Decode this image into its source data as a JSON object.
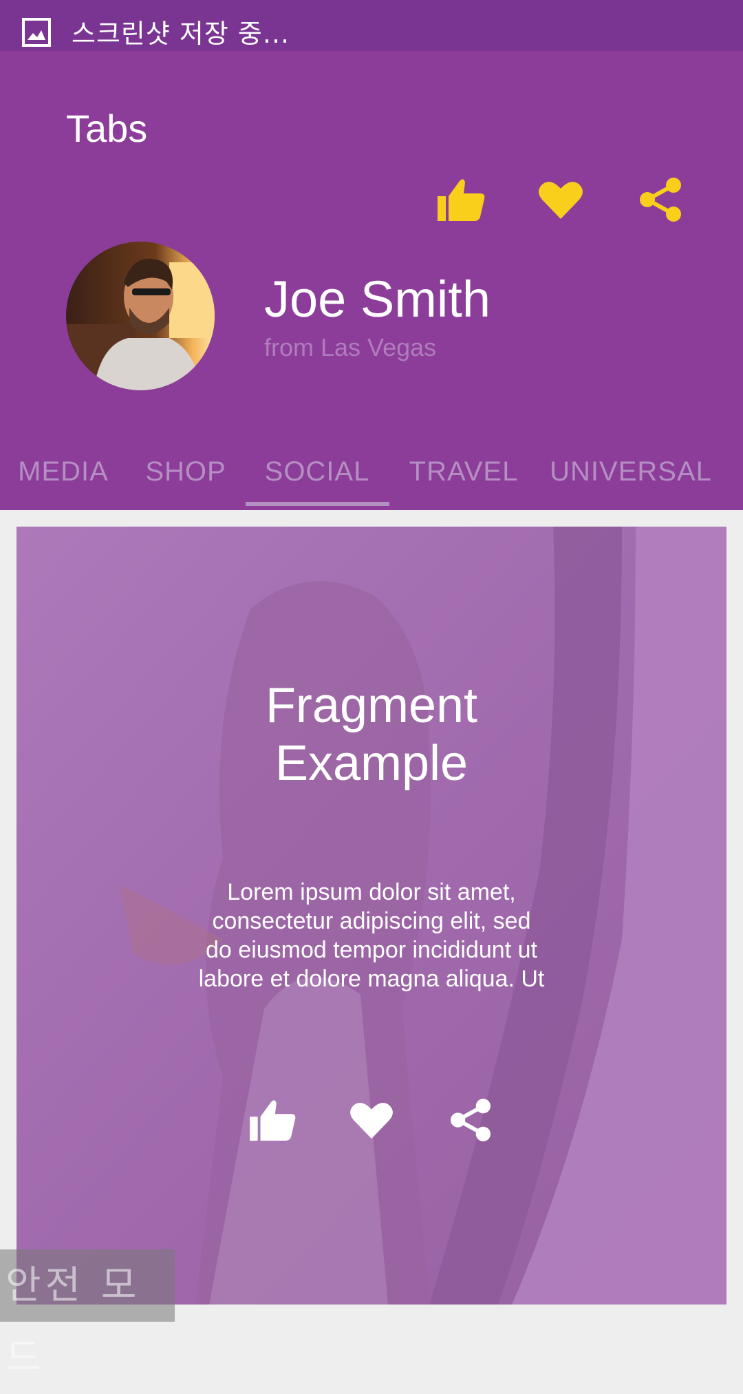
{
  "status_bar": {
    "text": "스크린샷 저장 중..."
  },
  "app_bar": {
    "title": "Tabs"
  },
  "profile": {
    "name": "Joe Smith",
    "subtitle": "from Las Vegas"
  },
  "header_actions": [
    {
      "icon": "thumbs-up-icon"
    },
    {
      "icon": "heart-icon"
    },
    {
      "icon": "share-icon"
    }
  ],
  "tabs": [
    {
      "label": "MEDIA",
      "selected": false
    },
    {
      "label": "SHOP",
      "selected": false
    },
    {
      "label": "SOCIAL",
      "selected": true
    },
    {
      "label": "TRAVEL",
      "selected": false
    },
    {
      "label": "UNIVERSAL",
      "selected": false
    }
  ],
  "card": {
    "title_line1": "Fragment",
    "title_line2": "Example",
    "body_line1": "Lorem ipsum dolor sit amet,",
    "body_line2": "consectetur adipiscing elit, sed",
    "body_line3": "do eiusmod tempor incididunt ut",
    "body_line4": "labore et dolore magna aliqua. Ut"
  },
  "watermark": {
    "text": "안전 모드"
  },
  "colors": {
    "status_bar": "#7a3592",
    "header": "#8c3d99",
    "accent_yellow": "#f9cf1c",
    "tab_text": "#b58fc2",
    "card": "#a46bb0"
  }
}
